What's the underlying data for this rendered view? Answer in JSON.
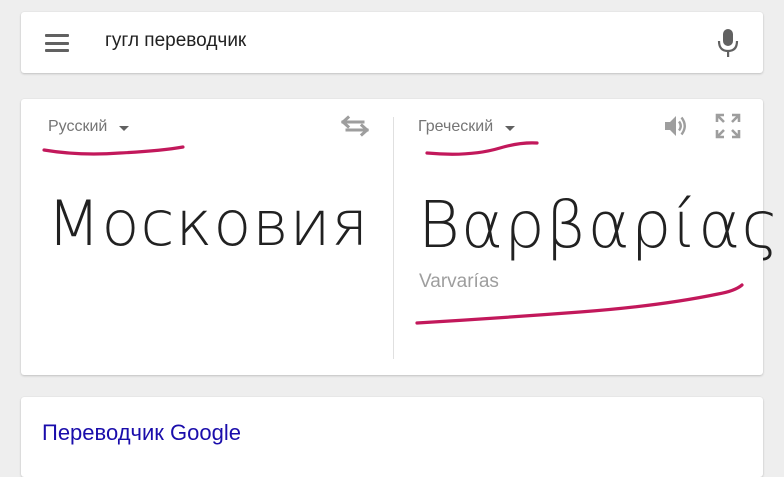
{
  "search": {
    "query": "гугл переводчик"
  },
  "icons": {
    "menu": "menu-icon",
    "mic": "microphone-icon",
    "swap": "swap-languages-icon",
    "speaker": "speaker-icon",
    "fullscreen": "fullscreen-icon"
  },
  "translator": {
    "source_language": "Русский",
    "target_language": "Греческий",
    "source_text": "Московия",
    "translated_text": "Βαρβαρίας",
    "transliteration": "Varvarías"
  },
  "result": {
    "title": "Переводчик Google"
  },
  "colors": {
    "annotation": "#c2185b",
    "link": "#1a0dab"
  }
}
